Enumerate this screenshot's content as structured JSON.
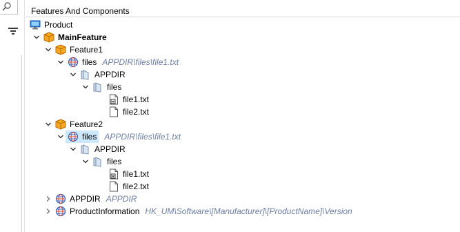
{
  "header": {
    "title": "Features And Components"
  },
  "tree": {
    "product": "Product",
    "main_feature": "MainFeature",
    "feature1": {
      "label": "Feature1",
      "files": {
        "label": "files",
        "path": "APPDIR\\files\\file1.txt"
      },
      "appdir": "APPDIR",
      "files_folder": "files",
      "file1": "file1.txt",
      "file2": "file2.txt"
    },
    "feature2": {
      "label": "Feature2",
      "files": {
        "label": "files",
        "path": "APPDIR\\files\\file1.txt"
      },
      "appdir": "APPDIR",
      "files_folder": "files",
      "file1": "file1.txt",
      "file2": "file2.txt"
    },
    "appdir": {
      "label": "APPDIR",
      "path": "APPDIR"
    },
    "product_information": {
      "label": "ProductInformation",
      "path": "HK_UM\\Software\\[Manufacturer]\\[ProductName]\\Version"
    }
  },
  "colors": {
    "selection": "#cce8ff",
    "path_text": "#6d7fa4",
    "feature_box": "#f5a623"
  },
  "icons": [
    "search-icon",
    "filter-icon",
    "computer-icon",
    "box-icon",
    "globe-icon",
    "folder-icon",
    "file-icon",
    "key-file-icon",
    "chevron-down-icon",
    "chevron-right-icon"
  ]
}
